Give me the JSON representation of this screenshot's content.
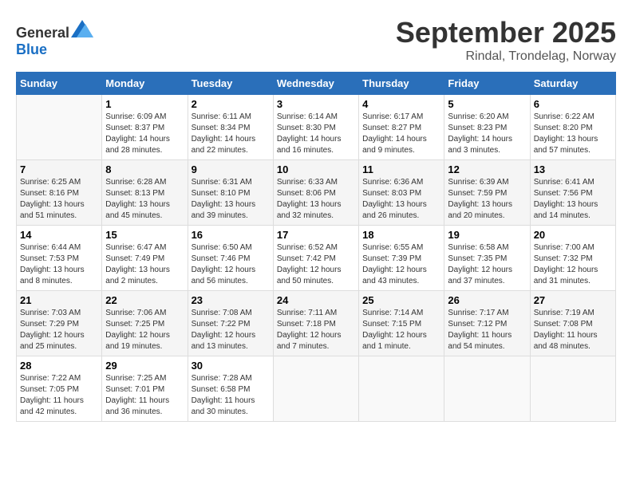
{
  "header": {
    "logo_general": "General",
    "logo_blue": "Blue",
    "month": "September 2025",
    "location": "Rindal, Trondelag, Norway"
  },
  "weekdays": [
    "Sunday",
    "Monday",
    "Tuesday",
    "Wednesday",
    "Thursday",
    "Friday",
    "Saturday"
  ],
  "weeks": [
    [
      {
        "day": "",
        "sunrise": "",
        "sunset": "",
        "daylight": ""
      },
      {
        "day": "1",
        "sunrise": "Sunrise: 6:09 AM",
        "sunset": "Sunset: 8:37 PM",
        "daylight": "Daylight: 14 hours and 28 minutes."
      },
      {
        "day": "2",
        "sunrise": "Sunrise: 6:11 AM",
        "sunset": "Sunset: 8:34 PM",
        "daylight": "Daylight: 14 hours and 22 minutes."
      },
      {
        "day": "3",
        "sunrise": "Sunrise: 6:14 AM",
        "sunset": "Sunset: 8:30 PM",
        "daylight": "Daylight: 14 hours and 16 minutes."
      },
      {
        "day": "4",
        "sunrise": "Sunrise: 6:17 AM",
        "sunset": "Sunset: 8:27 PM",
        "daylight": "Daylight: 14 hours and 9 minutes."
      },
      {
        "day": "5",
        "sunrise": "Sunrise: 6:20 AM",
        "sunset": "Sunset: 8:23 PM",
        "daylight": "Daylight: 14 hours and 3 minutes."
      },
      {
        "day": "6",
        "sunrise": "Sunrise: 6:22 AM",
        "sunset": "Sunset: 8:20 PM",
        "daylight": "Daylight: 13 hours and 57 minutes."
      }
    ],
    [
      {
        "day": "7",
        "sunrise": "Sunrise: 6:25 AM",
        "sunset": "Sunset: 8:16 PM",
        "daylight": "Daylight: 13 hours and 51 minutes."
      },
      {
        "day": "8",
        "sunrise": "Sunrise: 6:28 AM",
        "sunset": "Sunset: 8:13 PM",
        "daylight": "Daylight: 13 hours and 45 minutes."
      },
      {
        "day": "9",
        "sunrise": "Sunrise: 6:31 AM",
        "sunset": "Sunset: 8:10 PM",
        "daylight": "Daylight: 13 hours and 39 minutes."
      },
      {
        "day": "10",
        "sunrise": "Sunrise: 6:33 AM",
        "sunset": "Sunset: 8:06 PM",
        "daylight": "Daylight: 13 hours and 32 minutes."
      },
      {
        "day": "11",
        "sunrise": "Sunrise: 6:36 AM",
        "sunset": "Sunset: 8:03 PM",
        "daylight": "Daylight: 13 hours and 26 minutes."
      },
      {
        "day": "12",
        "sunrise": "Sunrise: 6:39 AM",
        "sunset": "Sunset: 7:59 PM",
        "daylight": "Daylight: 13 hours and 20 minutes."
      },
      {
        "day": "13",
        "sunrise": "Sunrise: 6:41 AM",
        "sunset": "Sunset: 7:56 PM",
        "daylight": "Daylight: 13 hours and 14 minutes."
      }
    ],
    [
      {
        "day": "14",
        "sunrise": "Sunrise: 6:44 AM",
        "sunset": "Sunset: 7:53 PM",
        "daylight": "Daylight: 13 hours and 8 minutes."
      },
      {
        "day": "15",
        "sunrise": "Sunrise: 6:47 AM",
        "sunset": "Sunset: 7:49 PM",
        "daylight": "Daylight: 13 hours and 2 minutes."
      },
      {
        "day": "16",
        "sunrise": "Sunrise: 6:50 AM",
        "sunset": "Sunset: 7:46 PM",
        "daylight": "Daylight: 12 hours and 56 minutes."
      },
      {
        "day": "17",
        "sunrise": "Sunrise: 6:52 AM",
        "sunset": "Sunset: 7:42 PM",
        "daylight": "Daylight: 12 hours and 50 minutes."
      },
      {
        "day": "18",
        "sunrise": "Sunrise: 6:55 AM",
        "sunset": "Sunset: 7:39 PM",
        "daylight": "Daylight: 12 hours and 43 minutes."
      },
      {
        "day": "19",
        "sunrise": "Sunrise: 6:58 AM",
        "sunset": "Sunset: 7:35 PM",
        "daylight": "Daylight: 12 hours and 37 minutes."
      },
      {
        "day": "20",
        "sunrise": "Sunrise: 7:00 AM",
        "sunset": "Sunset: 7:32 PM",
        "daylight": "Daylight: 12 hours and 31 minutes."
      }
    ],
    [
      {
        "day": "21",
        "sunrise": "Sunrise: 7:03 AM",
        "sunset": "Sunset: 7:29 PM",
        "daylight": "Daylight: 12 hours and 25 minutes."
      },
      {
        "day": "22",
        "sunrise": "Sunrise: 7:06 AM",
        "sunset": "Sunset: 7:25 PM",
        "daylight": "Daylight: 12 hours and 19 minutes."
      },
      {
        "day": "23",
        "sunrise": "Sunrise: 7:08 AM",
        "sunset": "Sunset: 7:22 PM",
        "daylight": "Daylight: 12 hours and 13 minutes."
      },
      {
        "day": "24",
        "sunrise": "Sunrise: 7:11 AM",
        "sunset": "Sunset: 7:18 PM",
        "daylight": "Daylight: 12 hours and 7 minutes."
      },
      {
        "day": "25",
        "sunrise": "Sunrise: 7:14 AM",
        "sunset": "Sunset: 7:15 PM",
        "daylight": "Daylight: 12 hours and 1 minute."
      },
      {
        "day": "26",
        "sunrise": "Sunrise: 7:17 AM",
        "sunset": "Sunset: 7:12 PM",
        "daylight": "Daylight: 11 hours and 54 minutes."
      },
      {
        "day": "27",
        "sunrise": "Sunrise: 7:19 AM",
        "sunset": "Sunset: 7:08 PM",
        "daylight": "Daylight: 11 hours and 48 minutes."
      }
    ],
    [
      {
        "day": "28",
        "sunrise": "Sunrise: 7:22 AM",
        "sunset": "Sunset: 7:05 PM",
        "daylight": "Daylight: 11 hours and 42 minutes."
      },
      {
        "day": "29",
        "sunrise": "Sunrise: 7:25 AM",
        "sunset": "Sunset: 7:01 PM",
        "daylight": "Daylight: 11 hours and 36 minutes."
      },
      {
        "day": "30",
        "sunrise": "Sunrise: 7:28 AM",
        "sunset": "Sunset: 6:58 PM",
        "daylight": "Daylight: 11 hours and 30 minutes."
      },
      {
        "day": "",
        "sunrise": "",
        "sunset": "",
        "daylight": ""
      },
      {
        "day": "",
        "sunrise": "",
        "sunset": "",
        "daylight": ""
      },
      {
        "day": "",
        "sunrise": "",
        "sunset": "",
        "daylight": ""
      },
      {
        "day": "",
        "sunrise": "",
        "sunset": "",
        "daylight": ""
      }
    ]
  ]
}
